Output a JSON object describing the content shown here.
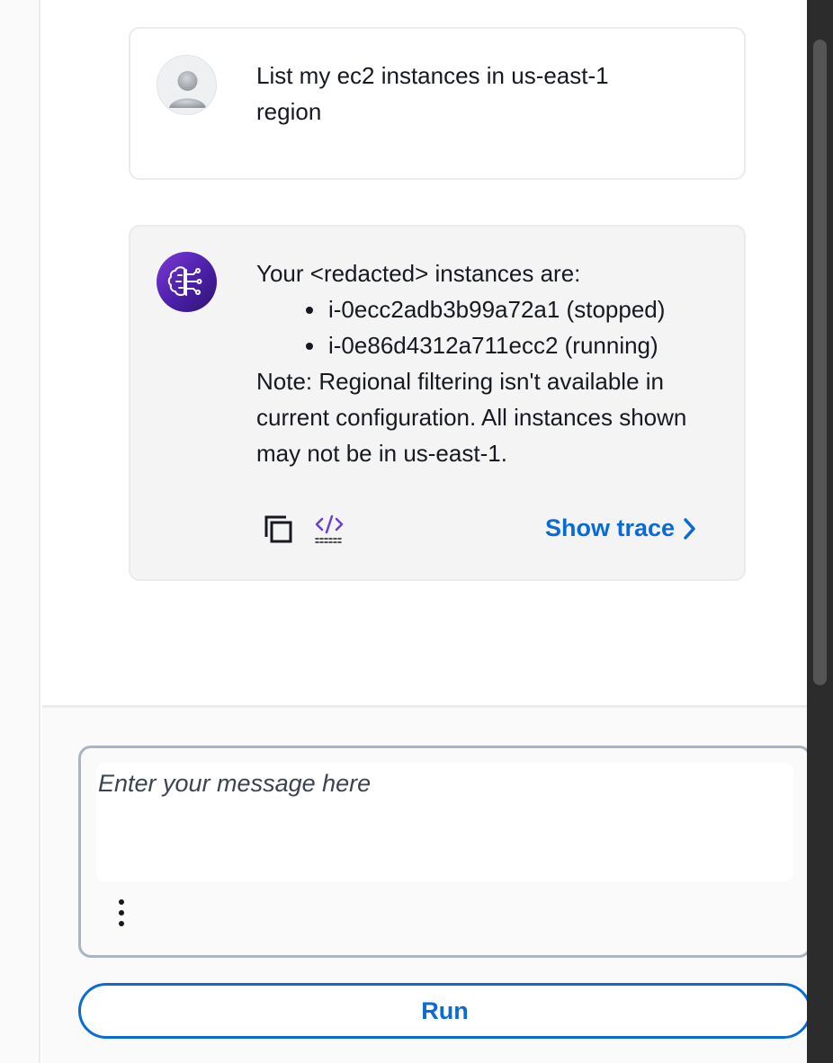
{
  "chat": {
    "user_message": {
      "text": "List my ec2 instances in us-east-1 region",
      "avatar_icon": "user-avatar-icon"
    },
    "assistant_message": {
      "intro": "Your <redacted> instances are:",
      "instances": [
        "i-0ecc2adb3b99a72a1 (stopped)",
        "i-0e86d4312a711ecc2 (running)"
      ],
      "note": "Note: Regional filtering isn't available in current configuration. All instances shown may not be in us-east-1.",
      "avatar_icon": "ai-brain-icon",
      "actions": {
        "copy_icon": "copy-icon",
        "code_icon": "code-icon",
        "show_trace_label": "Show trace"
      }
    }
  },
  "composer": {
    "placeholder": "Enter your message here",
    "value": "",
    "more_icon": "more-vertical-icon",
    "run_label": "Run"
  },
  "colors": {
    "accent": "#0a6bd6",
    "bot_avatar": "#5a28c0",
    "bot_bubble": "#f4f4f4",
    "border": "#e9ebed"
  }
}
